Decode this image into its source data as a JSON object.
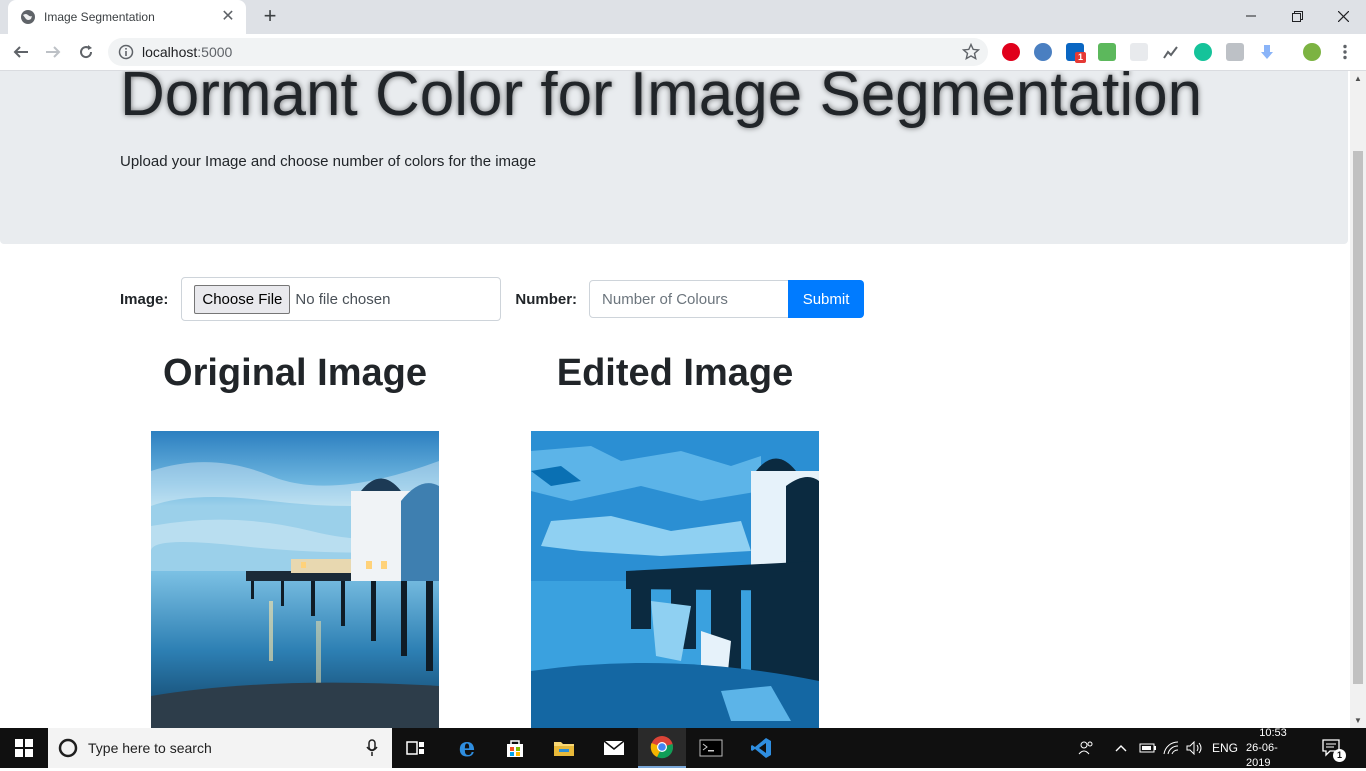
{
  "browser": {
    "tab_title": "Image Segmentation",
    "tab_close": "✕",
    "new_tab": "+",
    "url_host": "localhost",
    "url_port": ":5000",
    "extension_badge": "1"
  },
  "page": {
    "title": "Dormant Color for Image Segmentation",
    "subtitle": "Upload your Image and choose number of colors for the image",
    "form": {
      "image_label": "Image:",
      "choose_file_label": "Choose File",
      "no_file_text": "No file chosen",
      "number_label": "Number:",
      "number_placeholder": "Number of Colours",
      "submit_label": "Submit"
    },
    "original_heading": "Original Image",
    "edited_heading": "Edited Image"
  },
  "taskbar": {
    "search_placeholder": "Type here to search",
    "language": "ENG",
    "time": "10:53",
    "date": "26-06-2019",
    "notification_count": "1"
  },
  "colors": {
    "primary": "#007bff",
    "jumbotron": "#e9ecef",
    "tabstrip": "#dee1e6"
  }
}
